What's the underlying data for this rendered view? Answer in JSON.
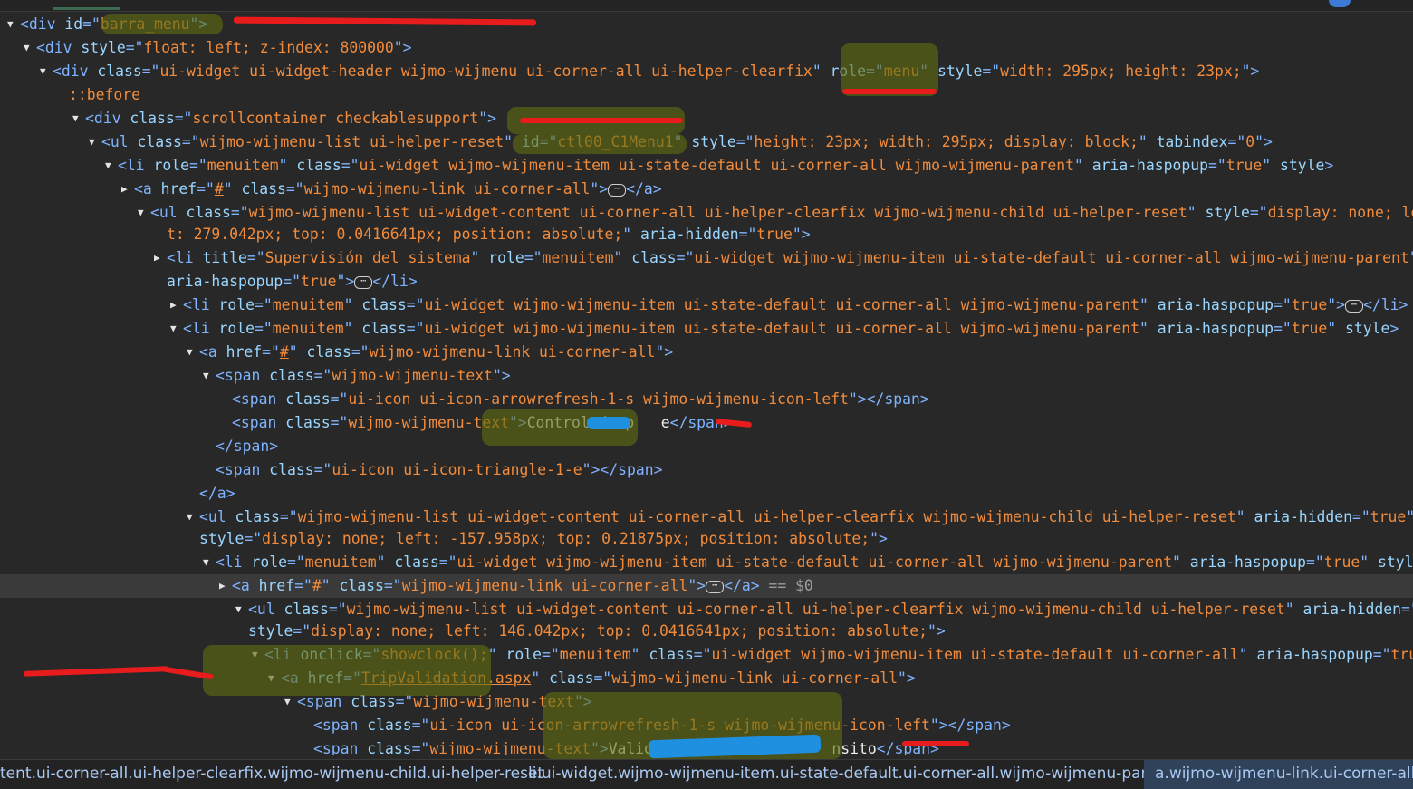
{
  "lines": [
    {
      "tw": "▼",
      "segs": [
        [
          "tag",
          "<div "
        ],
        [
          "an",
          "id"
        ],
        [
          "tag",
          "=\""
        ],
        [
          "av",
          "barra_menu"
        ],
        [
          "tag",
          "\">"
        ]
      ]
    },
    {
      "tw": "▼",
      "segs": [
        [
          "tag",
          "<div "
        ],
        [
          "an",
          "style"
        ],
        [
          "tag",
          "=\""
        ],
        [
          "av",
          "float: left; z-index: 800000"
        ],
        [
          "tag",
          "\">"
        ]
      ]
    },
    {
      "tw": "▼",
      "segs": [
        [
          "tag",
          "<div "
        ],
        [
          "an",
          "class"
        ],
        [
          "tag",
          "=\""
        ],
        [
          "av",
          "ui-widget ui-widget-header wijmo-wijmenu ui-corner-all ui-helper-clearfix"
        ],
        [
          "tag",
          "\" "
        ],
        [
          "an",
          "role"
        ],
        [
          "tag",
          "=\""
        ],
        [
          "av",
          "menu"
        ],
        [
          "tag",
          "\" "
        ],
        [
          "an",
          "style"
        ],
        [
          "tag",
          "=\""
        ],
        [
          "av",
          "width: 295px; height: 23px;"
        ],
        [
          "tag",
          "\">"
        ]
      ]
    },
    {
      "tw": "",
      "segs": [
        [
          "pseudo",
          "::before"
        ]
      ]
    },
    {
      "tw": "▼",
      "segs": [
        [
          "tag",
          "<div "
        ],
        [
          "an",
          "class"
        ],
        [
          "tag",
          "=\""
        ],
        [
          "av",
          "scrollcontainer checkablesupport"
        ],
        [
          "tag",
          "\">"
        ]
      ]
    },
    {
      "tw": "▼",
      "segs": [
        [
          "tag",
          "<ul "
        ],
        [
          "an",
          "class"
        ],
        [
          "tag",
          "=\""
        ],
        [
          "av",
          "wijmo-wijmenu-list ui-helper-reset"
        ],
        [
          "tag",
          "\" "
        ],
        [
          "an",
          "id"
        ],
        [
          "tag",
          "=\""
        ],
        [
          "av",
          "ctl00_C1Menu1"
        ],
        [
          "tag",
          "\" "
        ],
        [
          "an",
          "style"
        ],
        [
          "tag",
          "=\""
        ],
        [
          "av",
          "height: 23px; width: 295px; display: block;"
        ],
        [
          "tag",
          "\" "
        ],
        [
          "an",
          "tabindex"
        ],
        [
          "tag",
          "=\""
        ],
        [
          "av",
          "0"
        ],
        [
          "tag",
          "\">"
        ]
      ]
    },
    {
      "tw": "▼",
      "segs": [
        [
          "tag",
          "<li "
        ],
        [
          "an",
          "role"
        ],
        [
          "tag",
          "=\""
        ],
        [
          "av",
          "menuitem"
        ],
        [
          "tag",
          "\" "
        ],
        [
          "an",
          "class"
        ],
        [
          "tag",
          "=\""
        ],
        [
          "av",
          "ui-widget wijmo-wijmenu-item ui-state-default ui-corner-all wijmo-wijmenu-parent"
        ],
        [
          "tag",
          "\" "
        ],
        [
          "an",
          "aria-haspopup"
        ],
        [
          "tag",
          "=\""
        ],
        [
          "av",
          "true"
        ],
        [
          "tag",
          "\" "
        ],
        [
          "an",
          "style"
        ],
        [
          "tag",
          ">"
        ]
      ]
    },
    {
      "tw": "▶",
      "segs": [
        [
          "tag",
          "<a "
        ],
        [
          "an",
          "href"
        ],
        [
          "tag",
          "=\""
        ],
        [
          "avlink",
          "#"
        ],
        [
          "tag",
          "\" "
        ],
        [
          "an",
          "class"
        ],
        [
          "tag",
          "=\""
        ],
        [
          "av",
          "wijmo-wijmenu-link ui-corner-all"
        ],
        [
          "tag",
          "\">"
        ],
        [
          "ell",
          "⋯"
        ],
        [
          "tag",
          "</a>"
        ]
      ]
    },
    {
      "tw": "▼",
      "segs": [
        [
          "tag",
          "<ul "
        ],
        [
          "an",
          "class"
        ],
        [
          "tag",
          "=\""
        ],
        [
          "av",
          "wijmo-wijmenu-list ui-widget-content ui-corner-all ui-helper-clearfix wijmo-wijmenu-child ui-helper-reset"
        ],
        [
          "tag",
          "\" "
        ],
        [
          "an",
          "style"
        ],
        [
          "tag",
          "=\""
        ],
        [
          "av",
          "display: none; lef"
        ]
      ]
    },
    {
      "tw": "",
      "segs": [
        [
          "av",
          "t: 279.042px; top: 0.0416641px; position: absolute;"
        ],
        [
          "tag",
          "\" "
        ],
        [
          "an",
          "aria-hidden"
        ],
        [
          "tag",
          "=\""
        ],
        [
          "av",
          "true"
        ],
        [
          "tag",
          "\">"
        ]
      ]
    },
    {
      "tw": "▶",
      "segs": [
        [
          "tag",
          "<li "
        ],
        [
          "an",
          "title"
        ],
        [
          "tag",
          "=\""
        ],
        [
          "av",
          "Supervisión del sistema"
        ],
        [
          "tag",
          "\" "
        ],
        [
          "an",
          "role"
        ],
        [
          "tag",
          "=\""
        ],
        [
          "av",
          "menuitem"
        ],
        [
          "tag",
          "\" "
        ],
        [
          "an",
          "class"
        ],
        [
          "tag",
          "=\""
        ],
        [
          "av",
          "ui-widget wijmo-wijmenu-item ui-state-default ui-corner-all wijmo-wijmenu-parent"
        ],
        [
          "tag",
          "\""
        ]
      ]
    },
    {
      "tw": "",
      "segs": [
        [
          "an",
          "aria-haspopup"
        ],
        [
          "tag",
          "=\""
        ],
        [
          "av",
          "true"
        ],
        [
          "tag",
          "\">"
        ],
        [
          "ell",
          "⋯"
        ],
        [
          "tag",
          "</li>"
        ]
      ]
    },
    {
      "tw": "▶",
      "segs": [
        [
          "tag",
          "<li "
        ],
        [
          "an",
          "role"
        ],
        [
          "tag",
          "=\""
        ],
        [
          "av",
          "menuitem"
        ],
        [
          "tag",
          "\" "
        ],
        [
          "an",
          "class"
        ],
        [
          "tag",
          "=\""
        ],
        [
          "av",
          "ui-widget wijmo-wijmenu-item ui-state-default ui-corner-all wijmo-wijmenu-parent"
        ],
        [
          "tag",
          "\" "
        ],
        [
          "an",
          "aria-haspopup"
        ],
        [
          "tag",
          "=\""
        ],
        [
          "av",
          "true"
        ],
        [
          "tag",
          "\">"
        ],
        [
          "ell",
          "⋯"
        ],
        [
          "tag",
          "</li>"
        ]
      ]
    },
    {
      "tw": "▼",
      "segs": [
        [
          "tag",
          "<li "
        ],
        [
          "an",
          "role"
        ],
        [
          "tag",
          "=\""
        ],
        [
          "av",
          "menuitem"
        ],
        [
          "tag",
          "\" "
        ],
        [
          "an",
          "class"
        ],
        [
          "tag",
          "=\""
        ],
        [
          "av",
          "ui-widget wijmo-wijmenu-item ui-state-default ui-corner-all wijmo-wijmenu-parent"
        ],
        [
          "tag",
          "\" "
        ],
        [
          "an",
          "aria-haspopup"
        ],
        [
          "tag",
          "=\""
        ],
        [
          "av",
          "true"
        ],
        [
          "tag",
          "\" "
        ],
        [
          "an",
          "style"
        ],
        [
          "tag",
          ">"
        ]
      ]
    },
    {
      "tw": "▼",
      "segs": [
        [
          "tag",
          "<a "
        ],
        [
          "an",
          "href"
        ],
        [
          "tag",
          "=\""
        ],
        [
          "avlink",
          "#"
        ],
        [
          "tag",
          "\" "
        ],
        [
          "an",
          "class"
        ],
        [
          "tag",
          "=\""
        ],
        [
          "av",
          "wijmo-wijmenu-link ui-corner-all"
        ],
        [
          "tag",
          "\">"
        ]
      ]
    },
    {
      "tw": "▼",
      "segs": [
        [
          "tag",
          "<span "
        ],
        [
          "an",
          "class"
        ],
        [
          "tag",
          "=\""
        ],
        [
          "av",
          "wijmo-wijmenu-text"
        ],
        [
          "tag",
          "\">"
        ]
      ]
    },
    {
      "tw": "",
      "segs": [
        [
          "tag",
          "<span "
        ],
        [
          "an",
          "class"
        ],
        [
          "tag",
          "=\""
        ],
        [
          "av",
          "ui-icon ui-icon-arrowrefresh-1-s wijmo-wijmenu-icon-left"
        ],
        [
          "tag",
          "\"></span>"
        ]
      ]
    },
    {
      "tw": "",
      "segs": [
        [
          "tag",
          "<span "
        ],
        [
          "an",
          "class"
        ],
        [
          "tag",
          "=\""
        ],
        [
          "av",
          "wijmo-wijmenu-text"
        ],
        [
          "tag",
          "\">"
        ],
        [
          "txt",
          "Control de p   e"
        ],
        [
          "tag",
          "</span>"
        ]
      ]
    },
    {
      "tw": "",
      "segs": [
        [
          "tag",
          "</span>"
        ]
      ]
    },
    {
      "tw": "",
      "segs": [
        [
          "tag",
          "<span "
        ],
        [
          "an",
          "class"
        ],
        [
          "tag",
          "=\""
        ],
        [
          "av",
          "ui-icon ui-icon-triangle-1-e"
        ],
        [
          "tag",
          "\"></span>"
        ]
      ]
    },
    {
      "tw": "",
      "segs": [
        [
          "tag",
          "</a>"
        ]
      ]
    },
    {
      "tw": "▼",
      "segs": [
        [
          "tag",
          "<ul "
        ],
        [
          "an",
          "class"
        ],
        [
          "tag",
          "=\""
        ],
        [
          "av",
          "wijmo-wijmenu-list ui-widget-content ui-corner-all ui-helper-clearfix wijmo-wijmenu-child ui-helper-reset"
        ],
        [
          "tag",
          "\" "
        ],
        [
          "an",
          "aria-hidden"
        ],
        [
          "tag",
          "=\""
        ],
        [
          "av",
          "true"
        ],
        [
          "tag",
          "\""
        ]
      ]
    },
    {
      "tw": "",
      "segs": [
        [
          "an",
          "style"
        ],
        [
          "tag",
          "=\""
        ],
        [
          "av",
          "display: none; left: -157.958px; top: 0.21875px; position: absolute;"
        ],
        [
          "tag",
          "\">"
        ]
      ]
    },
    {
      "tw": "▼",
      "segs": [
        [
          "tag",
          "<li "
        ],
        [
          "an",
          "role"
        ],
        [
          "tag",
          "=\""
        ],
        [
          "av",
          "menuitem"
        ],
        [
          "tag",
          "\" "
        ],
        [
          "an",
          "class"
        ],
        [
          "tag",
          "=\""
        ],
        [
          "av",
          "ui-widget wijmo-wijmenu-item ui-state-default ui-corner-all wijmo-wijmenu-parent"
        ],
        [
          "tag",
          "\" "
        ],
        [
          "an",
          "aria-haspopup"
        ],
        [
          "tag",
          "=\""
        ],
        [
          "av",
          "true"
        ],
        [
          "tag",
          "\" "
        ],
        [
          "an",
          "style"
        ],
        [
          "tag",
          ">"
        ]
      ]
    },
    {
      "tw": "▶",
      "segs": [
        [
          "tag",
          "<a "
        ],
        [
          "an",
          "href"
        ],
        [
          "tag",
          "=\""
        ],
        [
          "avlink",
          "#"
        ],
        [
          "tag",
          "\" "
        ],
        [
          "an",
          "class"
        ],
        [
          "tag",
          "=\""
        ],
        [
          "av",
          "wijmo-wijmenu-link ui-corner-all"
        ],
        [
          "tag",
          "\">"
        ],
        [
          "ell",
          "⋯"
        ],
        [
          "tag",
          "</a>"
        ],
        [
          "dollar",
          " == $0"
        ]
      ]
    },
    {
      "tw": "▼",
      "segs": [
        [
          "tag",
          "<ul "
        ],
        [
          "an",
          "class"
        ],
        [
          "tag",
          "=\""
        ],
        [
          "av",
          "wijmo-wijmenu-list ui-widget-content ui-corner-all ui-helper-clearfix wijmo-wijmenu-child ui-helper-reset"
        ],
        [
          "tag",
          "\" "
        ],
        [
          "an",
          "aria-hidden"
        ],
        [
          "tag",
          "=\""
        ],
        [
          "av",
          "true"
        ],
        [
          "tag",
          "\""
        ]
      ]
    },
    {
      "tw": "",
      "segs": [
        [
          "an",
          "style"
        ],
        [
          "tag",
          "=\""
        ],
        [
          "av",
          "display: none; left: 146.042px; top: 0.0416641px; position: absolute;"
        ],
        [
          "tag",
          "\">"
        ]
      ]
    },
    {
      "tw": "▼",
      "segs": [
        [
          "tag",
          "<li "
        ],
        [
          "an",
          "onclick"
        ],
        [
          "tag",
          "=\""
        ],
        [
          "av",
          "showclock();"
        ],
        [
          "tag",
          "\" "
        ],
        [
          "an",
          "role"
        ],
        [
          "tag",
          "=\""
        ],
        [
          "av",
          "menuitem"
        ],
        [
          "tag",
          "\" "
        ],
        [
          "an",
          "class"
        ],
        [
          "tag",
          "=\""
        ],
        [
          "av",
          "ui-widget wijmo-wijmenu-item ui-state-default ui-corner-all"
        ],
        [
          "tag",
          "\" "
        ],
        [
          "an",
          "aria-haspopup"
        ],
        [
          "tag",
          "=\""
        ],
        [
          "av",
          "true"
        ],
        [
          "tag",
          "\">"
        ]
      ]
    },
    {
      "tw": "▼",
      "segs": [
        [
          "tag",
          "<a "
        ],
        [
          "an",
          "href"
        ],
        [
          "tag",
          "=\""
        ],
        [
          "avlink",
          "TripValidation.aspx"
        ],
        [
          "tag",
          "\" "
        ],
        [
          "an",
          "class"
        ],
        [
          "tag",
          "=\""
        ],
        [
          "av",
          "wijmo-wijmenu-link ui-corner-all"
        ],
        [
          "tag",
          "\">"
        ]
      ]
    },
    {
      "tw": "▼",
      "segs": [
        [
          "tag",
          "<span "
        ],
        [
          "an",
          "class"
        ],
        [
          "tag",
          "=\""
        ],
        [
          "av",
          "wijmo-wijmenu-text"
        ],
        [
          "tag",
          "\">"
        ]
      ]
    },
    {
      "tw": "",
      "segs": [
        [
          "tag",
          "<span "
        ],
        [
          "an",
          "class"
        ],
        [
          "tag",
          "=\""
        ],
        [
          "av",
          "ui-icon ui-icon-arrowrefresh-1-s wijmo-wijmenu-icon-left"
        ],
        [
          "tag",
          "\"></span>"
        ]
      ]
    },
    {
      "tw": "",
      "segs": [
        [
          "tag",
          "<span "
        ],
        [
          "an",
          "class"
        ],
        [
          "tag",
          "=\""
        ],
        [
          "av",
          "wijmo-wijmenu-text"
        ],
        [
          "tag",
          "\">"
        ],
        [
          "txt",
          "Validación t             nsito"
        ],
        [
          "tag",
          "</span>"
        ]
      ]
    }
  ],
  "breadcrumbs": [
    "tent.ui-corner-all.ui-helper-clearfix.wijmo-wijmenu-child.ui-helper-reset",
    "li.ui-widget.wijmo-wijmenu-item.ui-state-default.ui-corner-all.wijmo-wijmenu-parent",
    "a.wijmo-wijmenu-link.ui-corner-all"
  ],
  "colors": {
    "tag": "#7fb3ff",
    "attr_name": "#9ad6ff",
    "attr_value": "#f28c3c",
    "selected_row": "#3a3a3a",
    "breadcrumb": "#a9c8f2"
  }
}
